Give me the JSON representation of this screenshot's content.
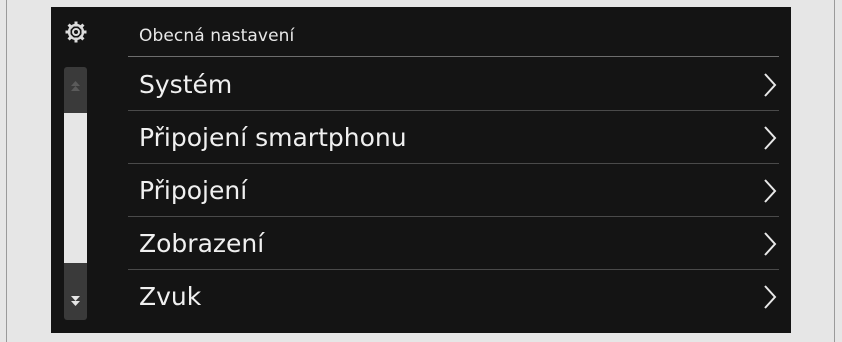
{
  "header": {
    "title": "Obecná nastavení",
    "icon": "gear-icon"
  },
  "menu": {
    "items": [
      {
        "label": "Systém"
      },
      {
        "label": "Připojení smartphonu"
      },
      {
        "label": "Připojení"
      },
      {
        "label": "Zobrazení"
      },
      {
        "label": "Zvuk"
      }
    ]
  },
  "scrollbar": {
    "position": 0.25,
    "up_icon": "scroll-up-icon",
    "down_icon": "scroll-down-icon"
  },
  "colors": {
    "background": "#141414",
    "text": "#f0f0f0",
    "divider": "#4a4a4a",
    "thumb": "#e6e6e6"
  }
}
